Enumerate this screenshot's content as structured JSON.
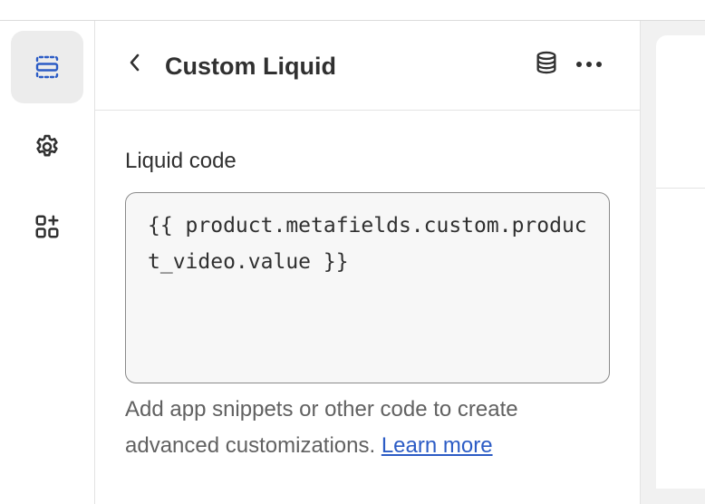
{
  "panel": {
    "title": "Custom Liquid"
  },
  "field": {
    "label": "Liquid code",
    "value": "{{ product.metafields.custom.product_video.value }}"
  },
  "help": {
    "text": "Add app snippets or other code to create advanced customizations. ",
    "link": "Learn more"
  },
  "icons": {
    "rail": [
      "sections-icon",
      "settings-gear-icon",
      "apps-add-icon"
    ],
    "header": [
      "chevron-left-icon",
      "database-icon",
      "more-horizontal-icon"
    ]
  },
  "colors": {
    "accent_active_icon": "#2c5cc5",
    "link": "#2c5cc5",
    "text": "#303030",
    "muted_text": "#616161"
  }
}
